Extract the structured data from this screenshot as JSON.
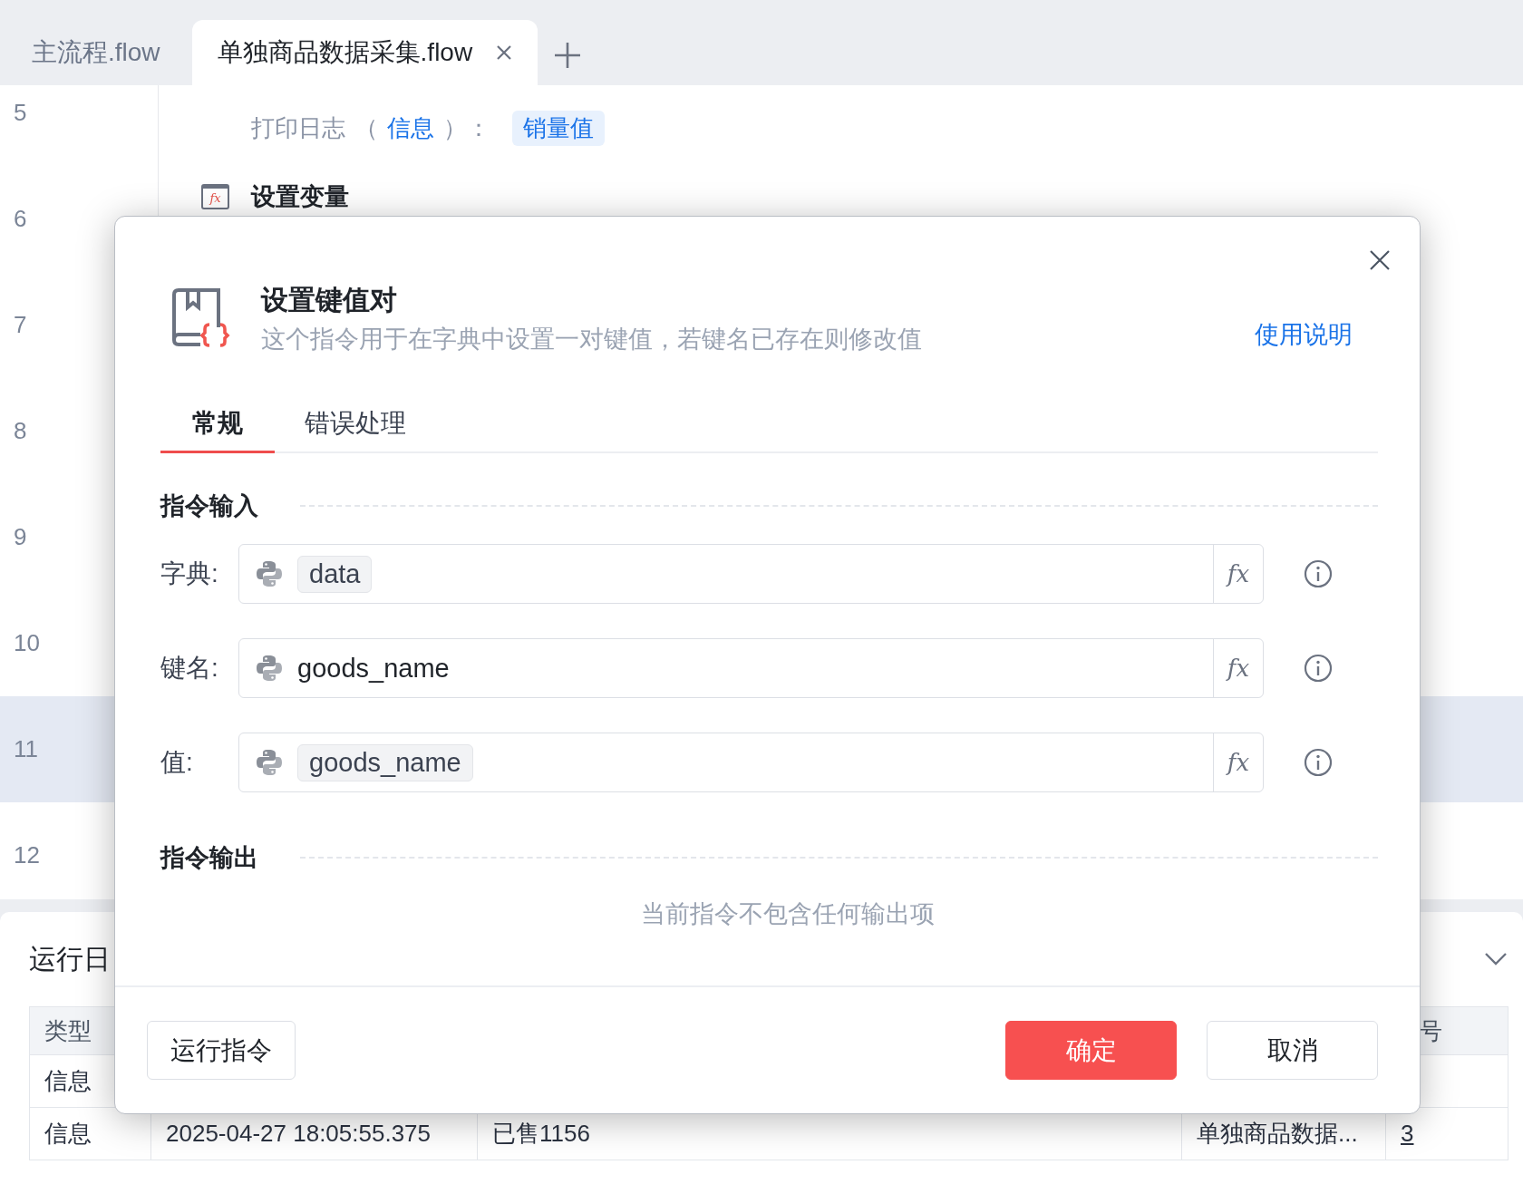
{
  "tabs": [
    {
      "label": "主流程.flow",
      "selected": false,
      "closable": false
    },
    {
      "label": "单独商品数据采集.flow",
      "selected": true,
      "closable": true
    }
  ],
  "editor": {
    "lines": [
      {
        "number": "5",
        "selected": false,
        "detail": [
          {
            "text": "打印日志",
            "kind": "plain"
          },
          {
            "text": "（",
            "kind": "plain"
          },
          {
            "text": "信息",
            "kind": "link"
          },
          {
            "text": "）：",
            "kind": "plain"
          },
          {
            "text": "销量值",
            "kind": "variable"
          }
        ]
      },
      {
        "number": "6",
        "selected": false,
        "title": "设置变量",
        "icon_text": "fx"
      },
      {
        "number": "7",
        "selected": false
      },
      {
        "number": "8",
        "selected": false
      },
      {
        "number": "9",
        "selected": false
      },
      {
        "number": "10",
        "selected": false
      },
      {
        "number": "11",
        "selected": true
      },
      {
        "number": "12",
        "selected": false
      }
    ]
  },
  "log_panel": {
    "title": "运行日",
    "header": {
      "column_1": "类型",
      "column_5": "号"
    },
    "rows": [
      {
        "column_1": "信息"
      },
      {
        "column_1": "信息",
        "column_2": "2025-04-27 18:05:55.375",
        "column_3": "已售1156",
        "column_4": "单独商品数据...",
        "column_5": "3"
      }
    ]
  },
  "dialog": {
    "title": "设置键值对",
    "description": "这个指令用于在字典中设置一对键值，若键名已存在则修改值",
    "help_link": "使用说明",
    "tabs": [
      {
        "label": "常规",
        "selected": true
      },
      {
        "label": "错误处理",
        "selected": false
      }
    ],
    "input_section": "指令输入",
    "fields": [
      {
        "label": "字典:",
        "value": "data",
        "kind": "variable",
        "formula_button": "fx"
      },
      {
        "label": "键名:",
        "value": "goods_name",
        "kind": "text",
        "formula_button": "fx"
      },
      {
        "label": "值:",
        "value": "goods_name",
        "kind": "variable",
        "formula_button": "fx"
      }
    ],
    "output_section": "指令输出",
    "output_empty": "当前指令不包含任何输出项",
    "run_button": "运行指令",
    "actions": [
      {
        "label": "确定",
        "kind": "primary"
      },
      {
        "label": "取消",
        "kind": "default"
      }
    ]
  }
}
